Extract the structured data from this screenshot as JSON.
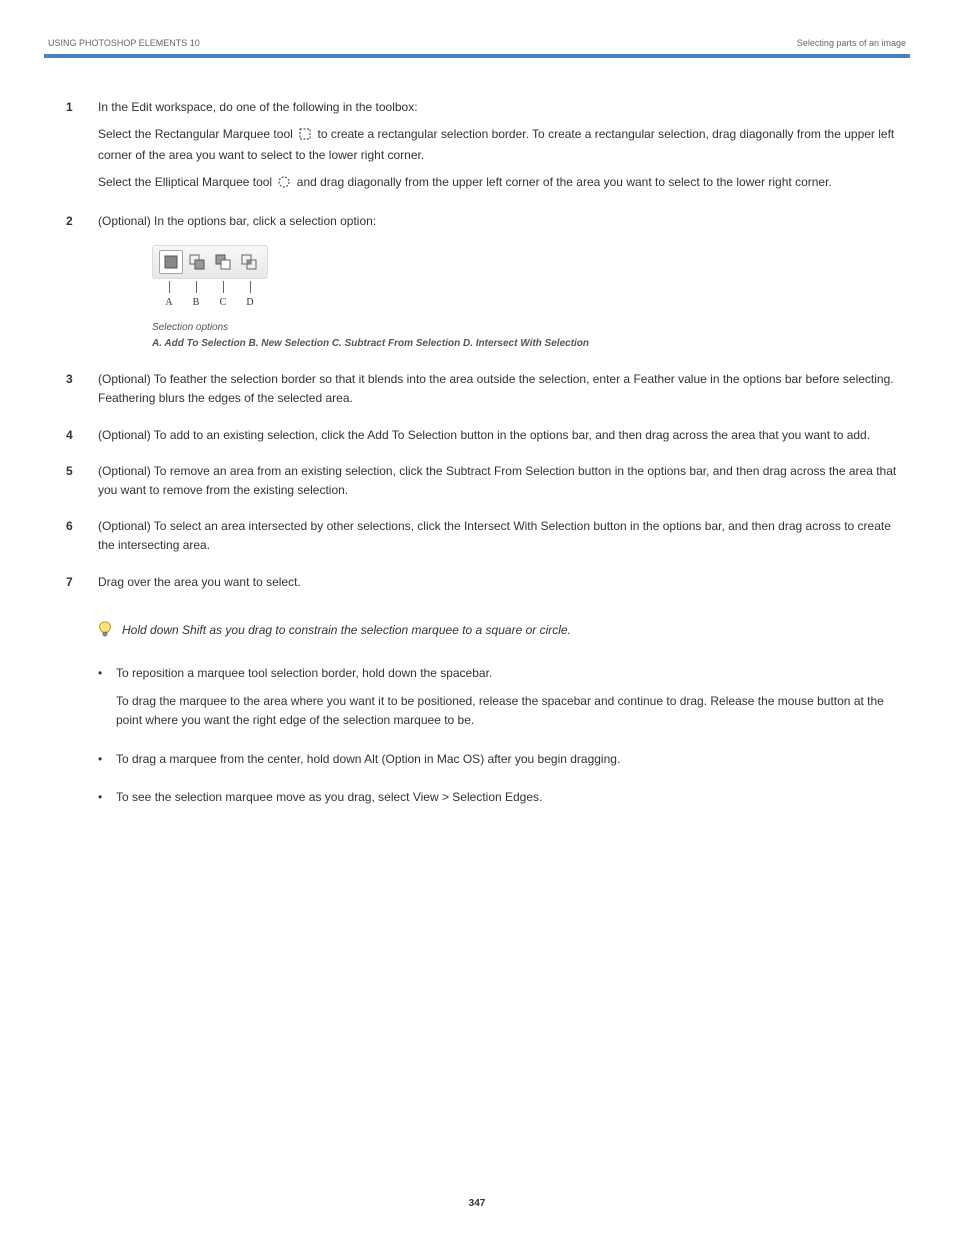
{
  "header": {
    "left": "USING PHOTOSHOP ELEMENTS 10",
    "right": "Selecting parts of an image"
  },
  "rule_color": "#4a7ec5",
  "step1": {
    "lead": "In the Edit workspace, do one of the following in the toolbox:",
    "opt_a_prefix": "Select the Rectangular Marquee tool",
    "opt_a_suffix": " to create a rectangular selection border. To create a rectangular selection, drag diagonally from the upper left corner of the area you want to select to the lower right corner.",
    "opt_b_prefix": "Select the Elliptical Marquee tool",
    "opt_b_suffix": " and drag diagonally from the upper left corner of the area you want to select to the lower right corner."
  },
  "step2": {
    "lead": "(Optional) In the options bar, click a selection option:",
    "caption_lead": "Selection options",
    "caption_detail": "A. Add To Selection  B. New Selection  C. Subtract From Selection  D. Intersect With Selection",
    "labels": [
      "A",
      "B",
      "C",
      "D"
    ],
    "btn_names": [
      "new-selection",
      "add-to-selection",
      "subtract-from-selection",
      "intersect-with-selection"
    ]
  },
  "step3": "(Optional) To feather the selection border so that it blends into the area outside the selection, enter a Feather value in the options bar before selecting. Feathering blurs the edges of the selected area.",
  "step4": "(Optional) To add to an existing selection, click the Add To Selection button in the options bar, and then drag across the area that you want to add.",
  "step5": "(Optional) To remove an area from an existing selection, click the Subtract From Selection button in the options bar, and then drag across the area that you want to remove from the existing selection.",
  "step6": "(Optional) To select an area intersected by other selections, click the Intersect With Selection button in the options bar, and then drag across to create the intersecting area.",
  "step7": "Drag over the area you want to select.",
  "tip": "Hold down Shift as you drag to constrain the selection marquee to a square or circle.",
  "bullets": [
    {
      "lead": "To reposition a marquee tool selection border, hold down the spacebar.",
      "extra": "To drag the marquee to the area where you want it to be positioned, release the spacebar and continue to drag. Release the mouse button at the point where you want the right edge of the selection marquee to be."
    },
    {
      "lead": "To drag a marquee from the center, hold down Alt (Option in Mac OS) after you begin dragging."
    },
    {
      "lead": "To see the selection marquee move as you drag, select View > Selection Edges."
    }
  ],
  "page_number": "347"
}
